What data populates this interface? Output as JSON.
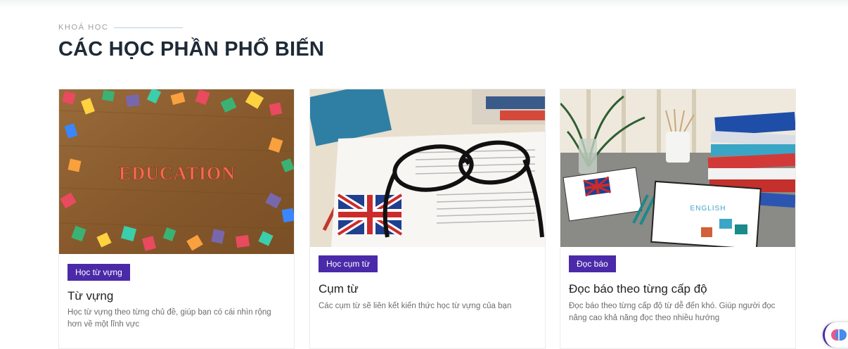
{
  "section": {
    "eyebrow": "KHOÁ HỌC",
    "title": "CÁC HỌC PHẦN PHỔ BIẾN"
  },
  "cards": [
    {
      "tag": "Học từ vựng",
      "title": "Từ vựng",
      "description": "Học từ vựng theo từng chủ đề, giúp bạn có cái nhìn rộng hơn về một lĩnh vực",
      "image_text": "EDUCATION"
    },
    {
      "tag": "Học cụm từ",
      "title": "Cụm từ",
      "description": "Các cụm từ sẽ liên kết kiến thức học từ vựng của bạn"
    },
    {
      "tag": "Đọc báo",
      "title": "Đọc báo theo từng cấp độ",
      "description": "Đọc báo theo từng cấp độ từ dễ đến khó. Giúp người đọc nâng cao khả năng đọc theo nhiều hướng",
      "image_text": "ENGLISH"
    }
  ],
  "colors": {
    "accent": "#4a2aa8",
    "title": "#1f2a36"
  }
}
